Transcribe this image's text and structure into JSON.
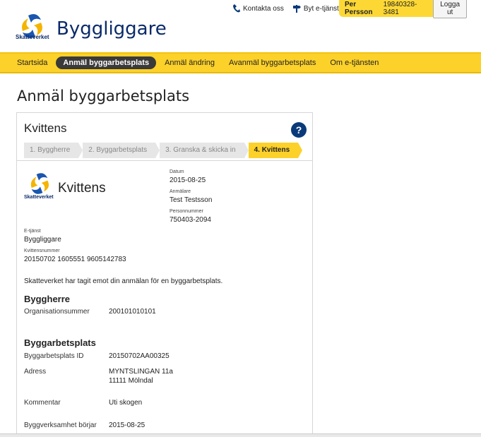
{
  "header": {
    "app_title": "Byggliggare",
    "logo_text": "Skatteverket",
    "contact_label": "Kontakta oss",
    "switch_label": "Byt e-tjänst",
    "user_name": "Per Persson",
    "user_pnr": "19840328-3481",
    "logout_label": "Logga ut"
  },
  "nav": {
    "items": [
      "Startsida",
      "Anmäl byggarbetsplats",
      "Anmäl ändring",
      "Avanmäl byggarbetsplats",
      "Om e-tjänsten"
    ]
  },
  "page_title": "Anmäl byggarbetsplats",
  "card": {
    "title": "Kvittens",
    "help": "?",
    "steps": [
      "1. Byggherre",
      "2. Byggarbetsplats",
      "3. Granska & skicka in",
      "4. Kvittens"
    ]
  },
  "receipt": {
    "logo_text": "Skatteverket",
    "title": "Kvittens",
    "datum_label": "Datum",
    "datum": "2015-08-25",
    "anmalare_label": "Anmälare",
    "anmalare": "Test Testsson",
    "pnr_label": "Personnummer",
    "pnr": "750403-2094",
    "etjanst_label": "E-tjänst",
    "etjanst": "Byggliggare",
    "kvittensnr_label": "Kvittensnummer",
    "kvittensnr": "20150702 1605551 9605142783",
    "message": "Skatteverket har tagit emot din anmälan för en byggarbetsplats.",
    "byggherre_heading": "Byggherre",
    "orgnr_label": "Organisationsummer",
    "orgnr": "200101010101",
    "byggarb_heading": "Byggarbetsplats",
    "id_label": "Byggarbetsplats ID",
    "id": "20150702AA00325",
    "adress_label": "Adress",
    "adress_line1": "MYNTSLINGAN 11a",
    "adress_line2": "11111 Mölndal",
    "kommentar_label": "Kommentar",
    "kommentar": "Uti skogen",
    "borjar_label": "Byggverksamhet börjar",
    "borjar": "2015-08-25"
  }
}
